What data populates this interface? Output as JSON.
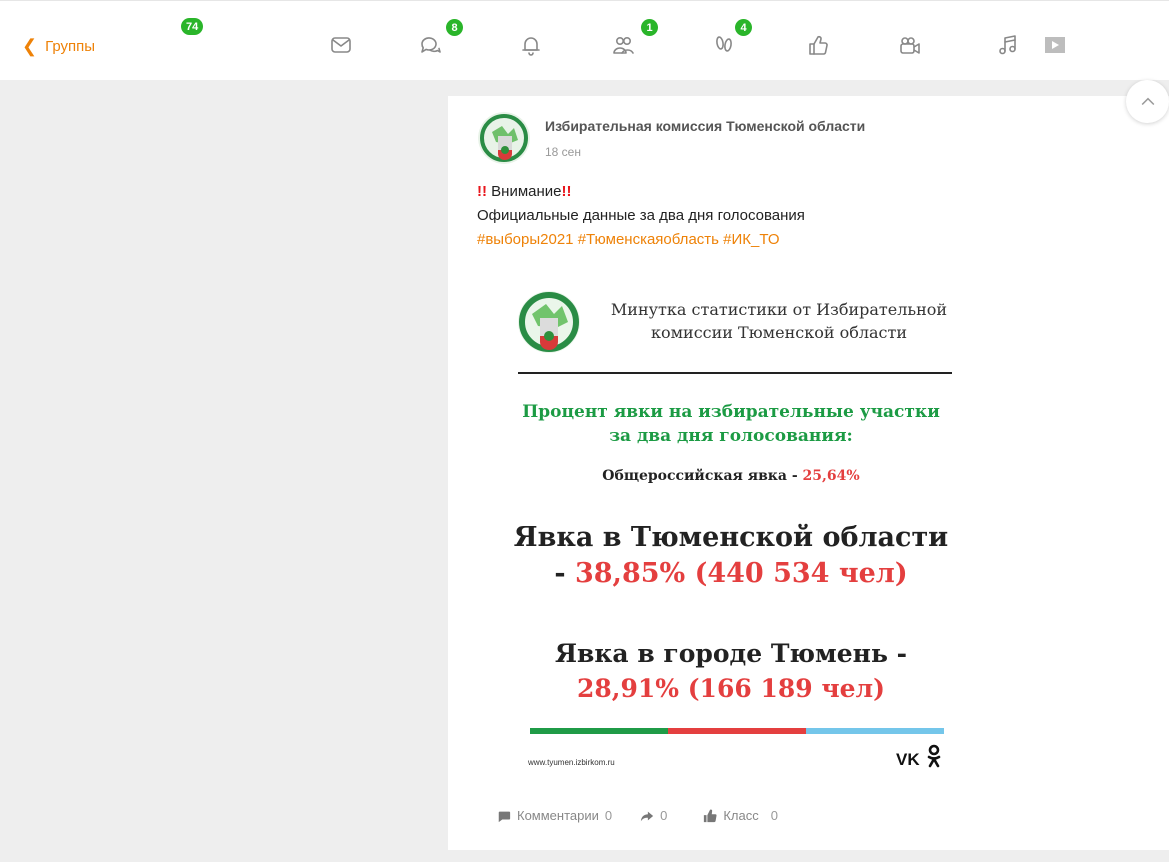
{
  "topbar": {
    "back_label": "Группы",
    "badges": {
      "groups": "74",
      "discussions": "8",
      "friends": "1",
      "guests": "4"
    },
    "icons": [
      "mail-icon",
      "discussions-icon",
      "bell-icon",
      "friends-icon",
      "footprints-icon",
      "like-icon",
      "video-icon",
      "music-icon",
      "video-play-icon"
    ]
  },
  "post": {
    "author": "Избирательная комиссия Тюменской области",
    "date": "18 сен",
    "attention": "Внимание",
    "attention_mark": "!!",
    "text": "Официальные данные за два дня голосования",
    "hashtags": [
      "#выборы2021",
      "#Тюменскаяобласть",
      "#ИК_ТО"
    ],
    "image": {
      "header_line1": "Минутка статистики от Избирательной",
      "header_line2": "комиссии Тюменской области",
      "green_line1": "Процент явки на избирательные участки",
      "green_line2": "за два дня голосования:",
      "allrussia_label": "Общероссийская явка - ",
      "allrussia_value": "25,64%",
      "region_line1": "Явка в Тюменской области",
      "region_dash": "- ",
      "region_value": "38,85% (440 534 чел)",
      "city_line1": "Явка в городе Тюмень -",
      "city_value": "28,91% (166 189 чел)",
      "site": "www.tyumen.izbirkom.ru",
      "vk_logo": "vk",
      "bar_colors": [
        "#1f9b47",
        "#e43f3f",
        "#74c6ea"
      ]
    },
    "actions": {
      "comments_label": "Комментарии",
      "comments_count": "0",
      "shares_count": "0",
      "likes_label": "Класс",
      "likes_count": "0"
    }
  },
  "colors": {
    "accent": "#ee8208",
    "badge": "#2ab52a",
    "highlight_red": "#e43f3f",
    "highlight_green": "#1c9b44"
  }
}
